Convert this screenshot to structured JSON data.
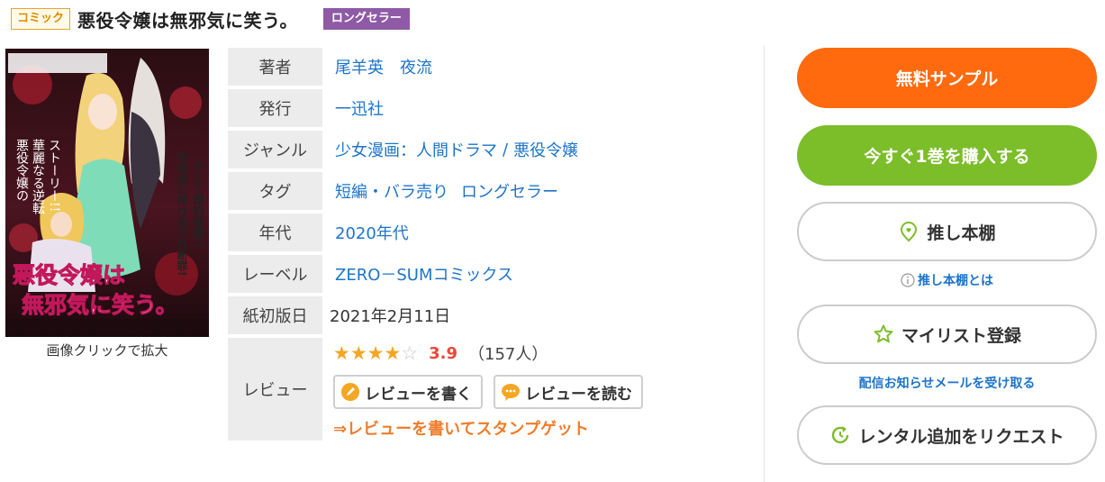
{
  "header": {
    "genre_badge": "コミック",
    "title": "悪役令嬢は無邪気に笑う。",
    "badge": "ロングセラー"
  },
  "cover": {
    "caption": "画像クリックで拡大",
    "art_title": "悪役令嬢は無邪気に笑う。"
  },
  "info": {
    "author": {
      "label": "著者",
      "values": [
        "尾羊英",
        "夜流"
      ]
    },
    "publisher": {
      "label": "発行",
      "value": "一迅社"
    },
    "genre": {
      "label": "ジャンル",
      "values": [
        "少女漫画：人間ドラマ",
        "悪役令嬢"
      ],
      "separator": "/"
    },
    "tags": {
      "label": "タグ",
      "values": [
        "短編・バラ売り",
        "ロングセラー"
      ]
    },
    "era": {
      "label": "年代",
      "value": "2020年代"
    },
    "label": {
      "label": "レーベル",
      "value": "ZERO－SUMコミックス"
    },
    "first_print": {
      "label": "紙初版日",
      "value": "2021年2月11日"
    }
  },
  "review": {
    "label": "レビュー",
    "rating": 3.9,
    "score_text": "3.9",
    "count_text": "（157人）",
    "write_label": "レビューを書く",
    "read_label": "レビューを読む",
    "stamp_link": "⇒レビューを書いてスタンプゲット"
  },
  "actions": {
    "sample": "無料サンプル",
    "buy": "今すぐ1巻を購入する",
    "oshi": "推し本棚",
    "oshi_help": "推し本棚とは",
    "mylist": "マイリスト登録",
    "mail": "配信お知らせメールを受け取る",
    "rental": "レンタル追加をリクエスト"
  },
  "colors": {
    "sample": "#ff6a0f",
    "buy": "#7cbd2a",
    "link": "#1e74c9",
    "score": "#e8483a",
    "stamp": "#ef7d2b",
    "badge": "#8e5aa6"
  }
}
